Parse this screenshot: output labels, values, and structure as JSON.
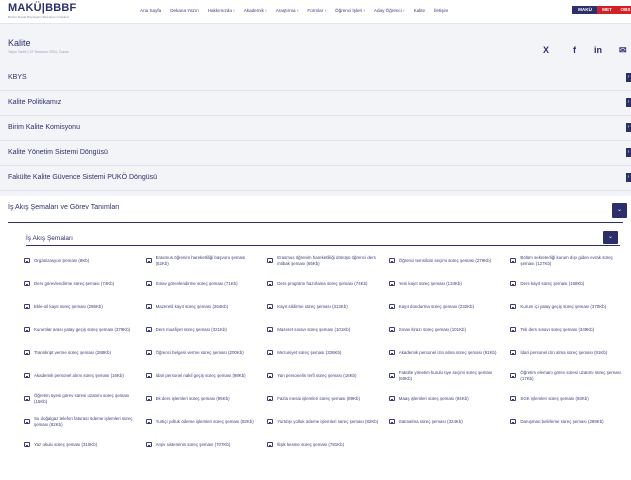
{
  "header": {
    "brand": "MAKÜ|BBBF",
    "brand_sub": "Burdur Bucak Büyükşehir Belediyesi Fakültesi",
    "nav": [
      "Ana Sayfa",
      "Dekana Yazın",
      "Hakkımızda ›",
      "Akademik ›",
      "Araştırma ›",
      "Formlar ›",
      "Öğrenci İşleri ›",
      "Aday Öğrenci ›",
      "Kalite",
      "İletişim"
    ],
    "badges": [
      "MAKÜ",
      "MET",
      "OBS"
    ]
  },
  "page": {
    "title": "Kalite",
    "meta": "Yayın Tarihi | 12 Temmuz 2024, Cuma",
    "share": [
      "X",
      "f",
      "in",
      "✉"
    ]
  },
  "accordion": [
    "KBYS",
    "Kalite Politikamız",
    "Birim Kalite Komisyonu",
    "Kalite Yönetim Sistemi Döngüsü",
    "Fakülte Kalite Güvence Sistemi PUKÖ Döngüsü"
  ],
  "panel": {
    "title": "İş Akış Şemaları ve Görev Tanımları",
    "sub_title": "İş Akış Şemaları",
    "files": [
      "Organizasyon Şeması (8Kb)",
      "Erasmus öğrenim hareketliliği başvuru şeması (52Kb)",
      "Erasmus öğrenim hareketliliği dönüşü öğrenci ders intibak şeması (65Kb)",
      "Öğrenci temsilcisi seçimi süreç şeması (279Kb)",
      "Bölüm sekreterliği kurum dışı giden evrak süreç şeması (127Kb)",
      "Ders görevlendirme süreç şeması (74Kb)",
      "Sınav görevlendirme süreç şeması (71Kb)",
      "Ders programı hazırlama süreç şeması (74Kb)",
      "Yeni kayıt süreç şeması (134Kb)",
      "Ders kayıt süreç şeması (168Kb)",
      "Ekle-sil kayıt süreç şeması (286Kb)",
      "Mazeretli kayıt süreç şeması (264Kb)",
      "Kayıt sildirme süreç şeması (313Kb)",
      "Kayıt dondurma süreç şeması (232Kb)",
      "Kurum içi yatay geçiş süreç şeması (370Kb)",
      "Kurumlar arası yatay geçiş süreç şeması (379Kb)",
      "Ders muafiyet süreç şeması (321Kb)",
      "Mazeret sınavı süreç şeması (101Kb)",
      "Sınav itirazı süreç şeması (101Kb)",
      "Tek ders sınavı süreç şeması (349Kb)",
      "Transkript verme süreç şeması (288Kb)",
      "Öğrenci belgesi verme süreç şeması (200Kb)",
      "Mezuniyet süreç şeması (336Kb)",
      "Akademik personel izin alma süreç şeması (91Kb)",
      "İdari personel izin alma süreç şeması (91Kb)",
      "Akademik personel alımı süreç şeması (16Kb)",
      "İdari personel nakil geçiş süreç şeması (98Kb)",
      "Yan personelin terfi süreç şeması (16Kb)",
      "Fakülte yönetim kurulu üye seçimi süreç şeması (60Kb)",
      "Öğretim elemanı görev süresi uzatımı süreç şeması (17Kb)",
      "Öğretim üyesi görev süresi uzatımı süreç şeması (15Kb)",
      "Ek ders işlemleri süreç şeması (95Kb)",
      "Fazla mesai işlemleri süreç şeması (89Kb)",
      "Maaş işlemleri süreç şeması (84Kb)",
      "SGK işlemleri süreç şeması (93Kb)",
      "Su doğalgaz telefon faturası ödeme işlemleri süreç şeması (82Kb)",
      "Yurtiçi yolluk ödeme işlemleri süreç şeması (82Kb)",
      "Yurtdışı yolluk ödeme işlemleri süreç şeması (82Kb)",
      "Satınalma süreç şeması (324Kb)",
      "Danışman belirleme süreç şeması (289Kb)",
      "Yaz okulu süreç şeması (310Kb)",
      "Arşiv sisteminin süreç şeması (707Kb)",
      "İlişik kesme süreç şeması (781Kb)"
    ]
  },
  "colors": {
    "primary": "#2d2f6b",
    "badge_red": "#d42027",
    "badge_navy": "#2d2f6b"
  }
}
